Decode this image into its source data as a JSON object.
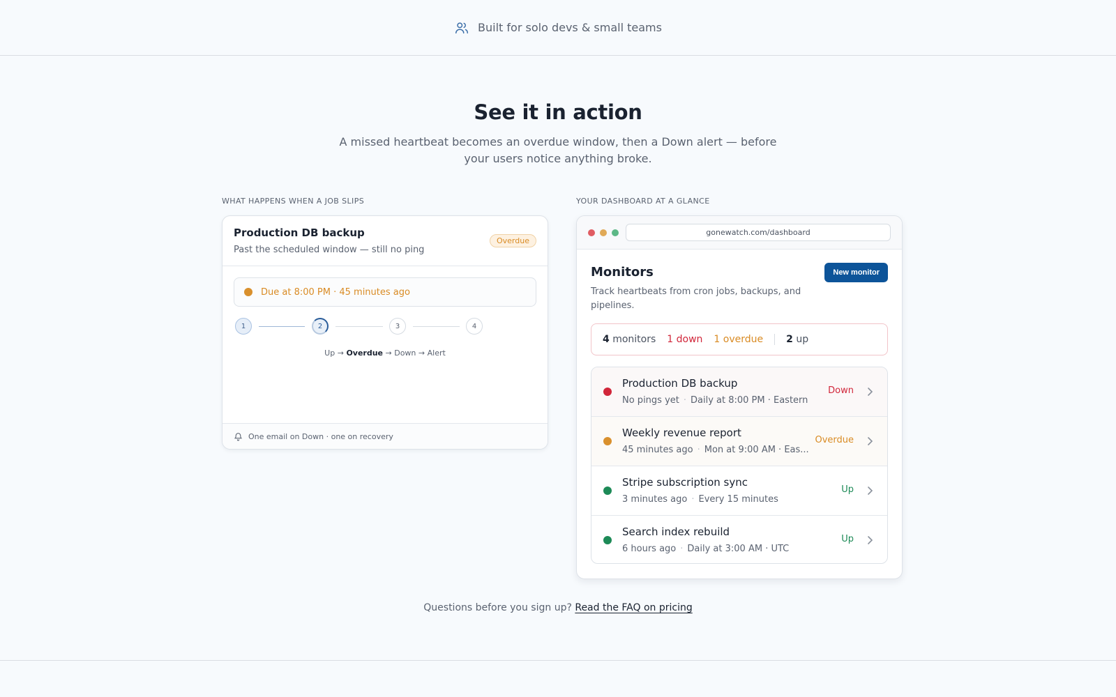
{
  "topbar": {
    "text": "Built for solo devs & small teams",
    "icon": "users-icon"
  },
  "hero": {
    "title": "See it in action",
    "subtitle": "A missed heartbeat becomes an overdue window, then a Down alert — before your users notice anything broke."
  },
  "left": {
    "section_label": "WHAT HAPPENS WHEN A JOB SLIPS",
    "title": "Production DB backup",
    "subtitle": "Past the scheduled window — still no ping",
    "badge": "Overdue",
    "due_text": "Due at 8:00 PM · 45 minutes ago",
    "steps": [
      "1",
      "2",
      "3",
      "4"
    ],
    "flow": {
      "up": "Up",
      "arrow": "→",
      "overdue": "Overdue",
      "down": "Down",
      "alert": "Alert"
    },
    "footer": "One email on Down · one on recovery"
  },
  "right": {
    "section_label": "YOUR DASHBOARD AT A GLANCE",
    "url": "gonewatch.com/dashboard",
    "title": "Monitors",
    "subtitle": "Track heartbeats from cron jobs, backups, and pipelines.",
    "new_button": "New monitor",
    "summary": {
      "monitors_n": "4",
      "monitors_label": "monitors",
      "down": "1 down",
      "overdue": "1 overdue",
      "up_n": "2",
      "up_label": "up"
    },
    "monitors": [
      {
        "name": "Production DB backup",
        "last": "No pings yet",
        "schedule": "Daily at 8:00 PM · Eastern",
        "status": "Down"
      },
      {
        "name": "Weekly revenue report",
        "last": "45 minutes ago",
        "schedule": "Mon at 9:00 AM · Eas...",
        "status": "Overdue"
      },
      {
        "name": "Stripe subscription sync",
        "last": "3 minutes ago",
        "schedule": "Every 15 minutes",
        "status": "Up"
      },
      {
        "name": "Search index rebuild",
        "last": "6 hours ago",
        "schedule": "Daily at 3:00 AM · UTC",
        "status": "Up"
      }
    ]
  },
  "faq": {
    "question": "Questions before you sign up?",
    "link": "Read the FAQ on pricing"
  },
  "colors": {
    "accent": "#0d5499",
    "down": "#d1263a",
    "overdue": "#d98b24",
    "up": "#1d8a57"
  }
}
